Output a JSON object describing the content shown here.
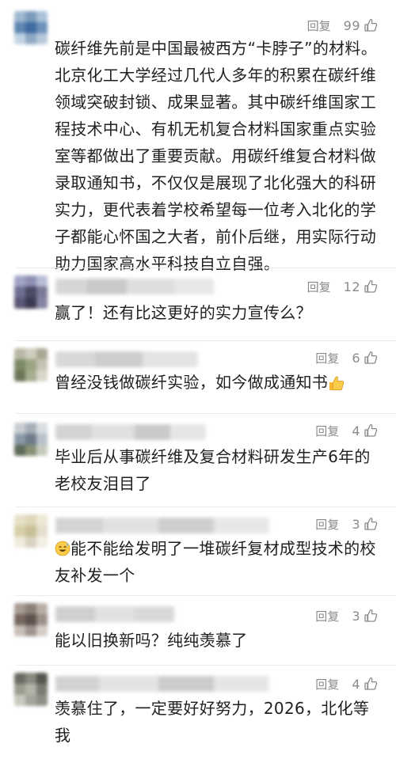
{
  "comments": [
    {
      "reply_label": "回复",
      "likes": "99",
      "text": "碳纤维先前是中国最被西方“卡脖子”的材料。北京化工大学经过几代人多年的积累在碳纤维领域突破封锁、成果显著。其中碳纤维国家工程技术中心、有机无机复合材料国家重点实验室等都做出了重要贡献。用碳纤维复合材料做录取通知书，不仅仅是展现了北化强大的科研实力，更代表着学校希望每一位考入北化的学子都能心怀国之大者，前仆后继，用实际行动助力国家高水平科技自立自强。"
    },
    {
      "reply_label": "回复",
      "likes": "12",
      "text": "赢了！还有比这更好的实力宣传么？"
    },
    {
      "reply_label": "回复",
      "likes": "6",
      "text": "曾经没钱做碳纤实验，如今做成通知书",
      "trailing_emoji": "thumbs-up-emoji"
    },
    {
      "reply_label": "回复",
      "likes": "4",
      "text": "毕业后从事碳纤维及复合材料研发生产6年的老校友泪目了"
    },
    {
      "reply_label": "回复",
      "likes": "3",
      "leading_emoji": "sweat-smile-emoji",
      "text": "能不能给发明了一堆碳纤复材成型技术的校友补发一个"
    },
    {
      "reply_label": "回复",
      "likes": "3",
      "text": "能以旧换新吗？纯纯羡慕了"
    },
    {
      "reply_label": "回复",
      "likes": "4",
      "text": "羡慕住了，一定要好好努力，2026，北化等我"
    }
  ],
  "colors": {
    "meta_text": "#8a8a8a",
    "body_text": "#1f1f1f",
    "divider": "#ececec"
  },
  "icons": {
    "like": "thumbs-up-outline-icon"
  }
}
